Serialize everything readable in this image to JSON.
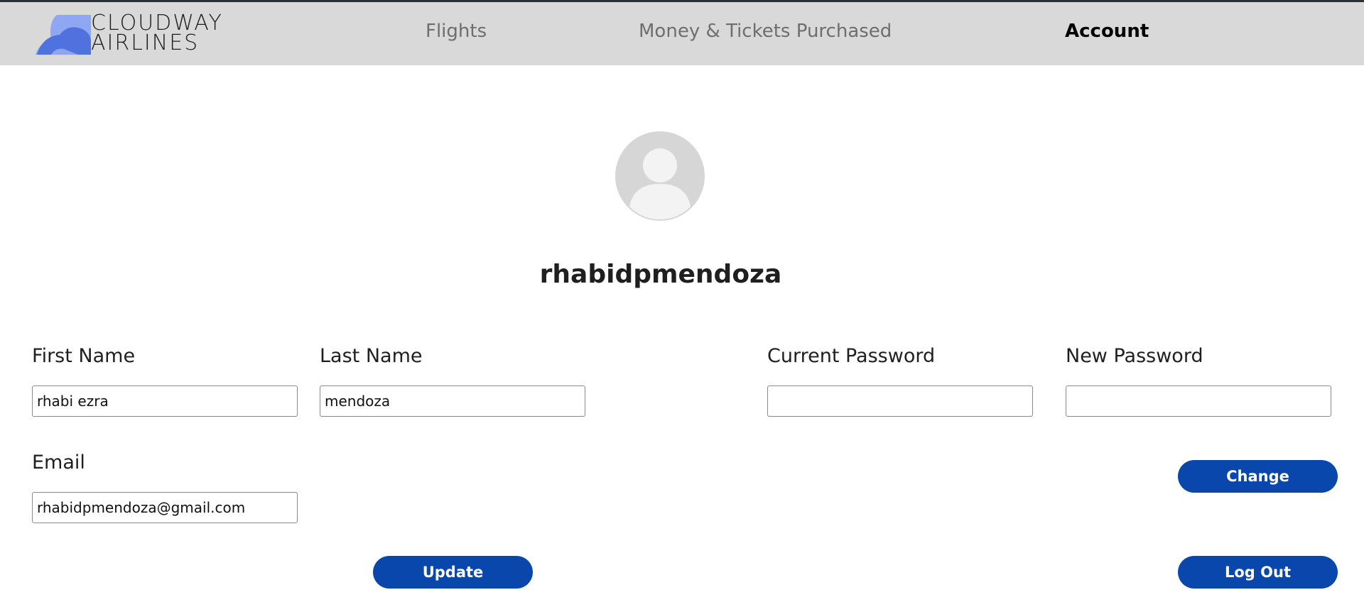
{
  "brand": {
    "line1": "CLOUDWAY",
    "line2": "AIRLINES",
    "colors": {
      "cloud_light": "#8fa6f2",
      "cloud_dark": "#4f72de"
    }
  },
  "nav": {
    "flights": "Flights",
    "money": "Money & Tickets Purchased",
    "account": "Account"
  },
  "profile": {
    "avatar_icon": "user-avatar-icon",
    "username": "rhabidpmendoza"
  },
  "form": {
    "first_name_label": "First Name",
    "first_name_value": "rhabi ezra",
    "last_name_label": "Last Name",
    "last_name_value": "mendoza",
    "email_label": "Email",
    "email_value": "rhabidpmendoza@gmail.com",
    "update_label": "Update"
  },
  "password": {
    "current_label": "Current Password",
    "current_value": "",
    "new_label": "New Password",
    "new_value": "",
    "change_label": "Change"
  },
  "session": {
    "logout_label": "Log Out"
  },
  "colors": {
    "navbar_bg": "#d9d9d9",
    "accent_button": "#0a47ad",
    "nav_inactive": "#6e6e6e",
    "nav_active": "#000000"
  }
}
